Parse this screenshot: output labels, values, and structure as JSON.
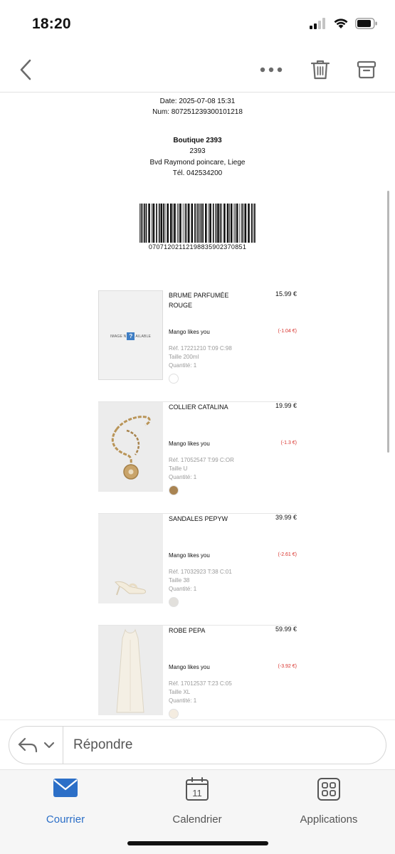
{
  "status_bar": {
    "time": "18:20",
    "signal_icon": "signal-icon",
    "wifi_icon": "wifi-icon",
    "battery_icon": "battery-icon"
  },
  "navbar": {
    "back_icon": "chevron-left-icon",
    "more_icon": "more-icon",
    "delete_icon": "trash-icon",
    "archive_icon": "archive-icon"
  },
  "receipt": {
    "date": "Date: 2025-07-08 15:31",
    "num": "Num: 807251239300101218",
    "store_name": "Boutique 2393",
    "store_code": "2393",
    "address": "Bvd Raymond poincare, Liege",
    "phone": "Tél. 042534200",
    "barcode_number": "07071202112198835902370851"
  },
  "items": [
    {
      "name": "BRUME PARFUMÉE ROUGE",
      "price": "15.99 €",
      "promo": "Mango likes you",
      "discount": "(-1.04 €)",
      "ref": "Réf. 17221210 T:09 C:98",
      "size": "Taille 200ml",
      "qty": "Quantité: 1",
      "image_text_left": "IMAGE N",
      "image_text_mark": "?",
      "image_text_right": "AILABLE",
      "swatch_color": "#ffffff"
    },
    {
      "name": "COLLIER CATALINA",
      "price": "19.99 €",
      "promo": "Mango likes you",
      "discount": "(-1.3 €)",
      "ref": "Réf. 17052547 T:99 C:OR",
      "size": "Taille U",
      "qty": "Quantité: 1",
      "swatch_color": "#a98452"
    },
    {
      "name": "SANDALES PEPYW",
      "price": "39.99 €",
      "promo": "Mango likes you",
      "discount": "(-2.61 €)",
      "ref": "Réf. 17032923 T:38 C:01",
      "size": "Taille 38",
      "qty": "Quantité: 1",
      "swatch_color": "#e2e0dc"
    },
    {
      "name": "ROBE PEPA",
      "price": "59.99 €",
      "promo": "Mango likes you",
      "discount": "(-3.92 €)",
      "ref": "Réf. 17012537 T:23 C:05",
      "size": "Taille XL",
      "qty": "Quantité: 1",
      "swatch_color": "#f4ece0"
    }
  ],
  "reply": {
    "placeholder": "Répondre",
    "reply_icon": "reply-icon",
    "dropdown_icon": "chevron-down-icon"
  },
  "tabs": [
    {
      "label": "Courrier",
      "icon": "mail-icon",
      "active": true
    },
    {
      "label": "Calendrier",
      "icon": "calendar-icon",
      "day": "11",
      "active": false
    },
    {
      "label": "Applications",
      "icon": "apps-icon",
      "active": false
    }
  ],
  "colors": {
    "accent": "#2c6fc7",
    "discount": "#d8312b"
  }
}
